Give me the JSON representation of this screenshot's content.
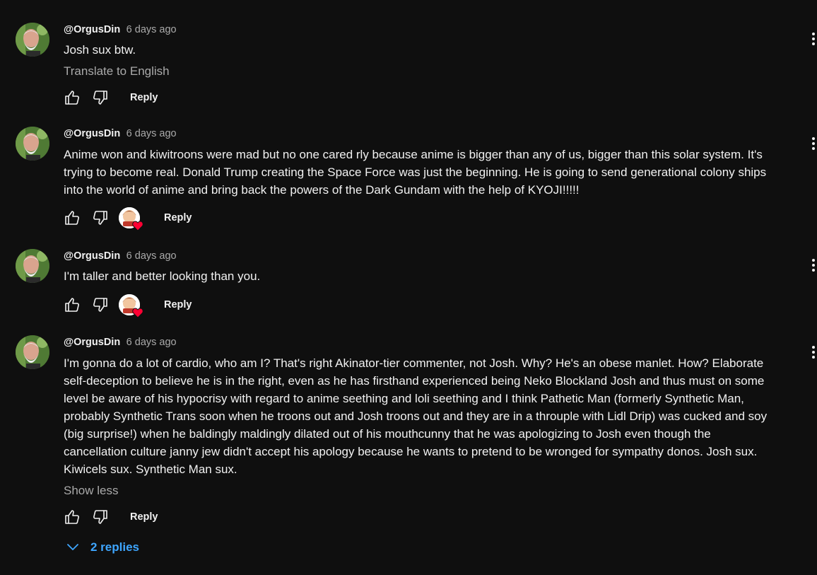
{
  "comments": [
    {
      "author": "@OrgusDin",
      "time": "6 days ago",
      "text": [
        "Josh sux btw."
      ],
      "translate": "Translate to English",
      "reply_label": "Reply",
      "creator_heart": false
    },
    {
      "author": "@OrgusDin",
      "time": "6 days ago",
      "text": [
        "Anime won and kiwitroons were mad but no one cared rly because anime is bigger than any of us, bigger than this solar system. It's",
        "trying to become real. Donald Trump creating the Space Force was just the beginning. He is going to send generational colony ships",
        "into the world of anime and bring back the powers of the Dark Gundam with the help of KYOJI!!!!!"
      ],
      "reply_label": "Reply",
      "creator_heart": true
    },
    {
      "author": "@OrgusDin",
      "time": "6 days ago",
      "text": [
        "I'm taller and better looking than you."
      ],
      "reply_label": "Reply",
      "creator_heart": true
    },
    {
      "author": "@OrgusDin",
      "time": "6 days ago",
      "text": [
        "I'm gonna do a lot of cardio, who am I? That's right Akinator-tier commenter, not Josh. Why? He's an obese manlet. How? Elaborate",
        "self-deception to believe he is in the right, even as he has firsthand experienced being Neko Blockland Josh and thus must on some",
        "level be aware of his hypocrisy with regard to anime seething and loli seething and I think Pathetic Man (formerly Synthetic Man,",
        "probably Synthetic Trans soon when he troons out and Josh troons out and they are in a throuple with Lidl Drip) was cucked and soy",
        "(big surprise!) when he baldingly maldingly dilated out of his mouthcunny that he was apologizing to Josh even though the",
        "cancellation culture janny jew didn't accept his apology because he wants to pretend to be wronged for sympathy donos. Josh sux.",
        "Kiwicels sux. Synthetic Man sux."
      ],
      "show_less": "Show less",
      "reply_label": "Reply",
      "creator_heart": false,
      "replies_label": "2 replies"
    }
  ],
  "icons": {
    "like": "thumbs-up-icon",
    "dislike": "thumbs-down-icon",
    "more": "more-vertical-icon",
    "expand": "chevron-down-icon",
    "heart": "heart-icon"
  },
  "colors": {
    "background": "#0f0f0f",
    "text": "#f1f1f1",
    "secondary": "#aaaaaa",
    "link": "#3ea6ff",
    "heart": "#ff0033"
  }
}
